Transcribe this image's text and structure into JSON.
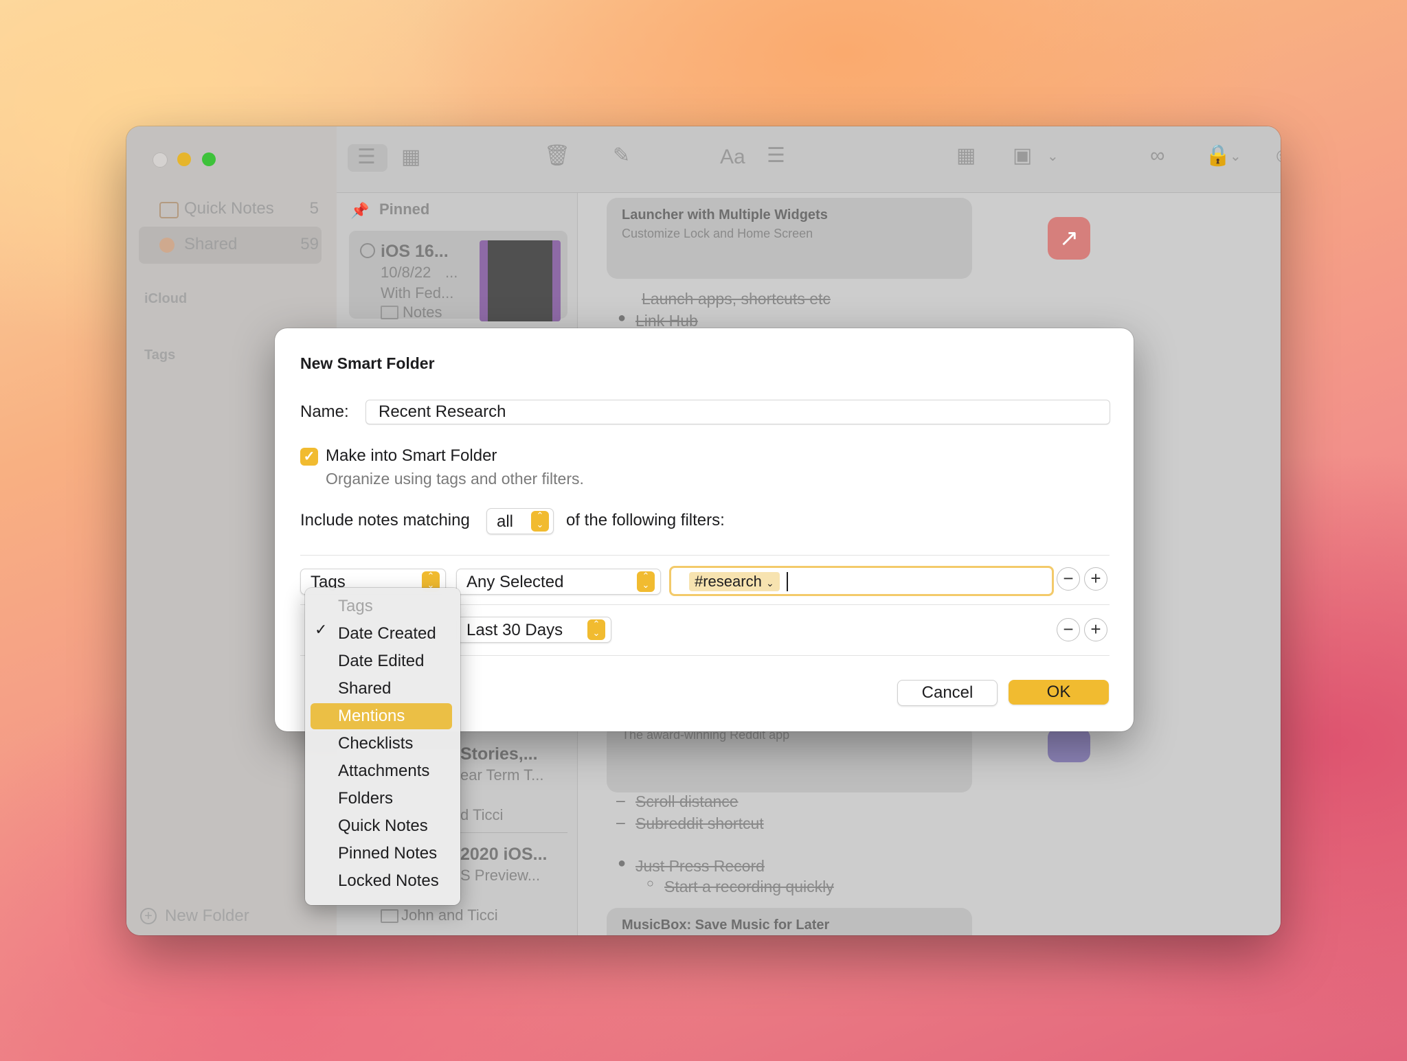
{
  "sidebar": {
    "items": [
      {
        "label": "Quick Notes",
        "count": "5"
      },
      {
        "label": "Shared",
        "count": "59"
      }
    ],
    "sections": [
      "iCloud",
      "Tags"
    ],
    "new_folder": "New Folder"
  },
  "note_list": {
    "pinned": "Pinned",
    "notes": [
      {
        "title": "iOS 16...",
        "date": "10/8/22",
        "date_suffix": "...",
        "preview": "With Fed...",
        "folder": "Notes"
      },
      {
        "title": "Stories,...",
        "preview": "ear Term T...",
        "folder": "d Ticci"
      },
      {
        "title": "2020 iOS...",
        "preview": "S Preview...",
        "folder": "John and Ticci"
      }
    ]
  },
  "editor": {
    "card1_title": "Launcher with Multiple Widgets",
    "card1_subtitle": "Customize Lock and Home Screen",
    "line1": "Launch apps, shortcuts etc",
    "line2": "Link Hub",
    "card2_subtitle": "The award-winning Reddit app",
    "line3": "Scroll distance",
    "line4": "Subreddit shortcut",
    "line5": "Just Press Record",
    "line6": "Start a recording quickly",
    "card3_title": "MusicBox: Save Music for Later"
  },
  "dialog": {
    "title": "New Smart Folder",
    "name_label": "Name:",
    "name_value": "Recent Research",
    "checkbox_label": "Make into Smart Folder",
    "checkbox_sub": "Organize using tags and other filters.",
    "include_prefix": "Include notes matching",
    "match_value": "all",
    "include_suffix": "of the following filters:",
    "filter1": {
      "field": "Tags",
      "operator": "Any Selected",
      "token": "#research"
    },
    "filter2": {
      "operator": "Last 30 Days"
    },
    "cancel": "Cancel",
    "ok": "OK"
  },
  "menu": {
    "items": [
      "Tags",
      "Date Created",
      "Date Edited",
      "Shared",
      "Mentions",
      "Checklists",
      "Attachments",
      "Folders",
      "Quick Notes",
      "Pinned Notes",
      "Locked Notes"
    ],
    "checked": "Date Created",
    "highlighted": "Mentions",
    "disabled": "Tags"
  },
  "colors": {
    "accent": "#f1bb30",
    "highlight": "#ebbf45"
  }
}
